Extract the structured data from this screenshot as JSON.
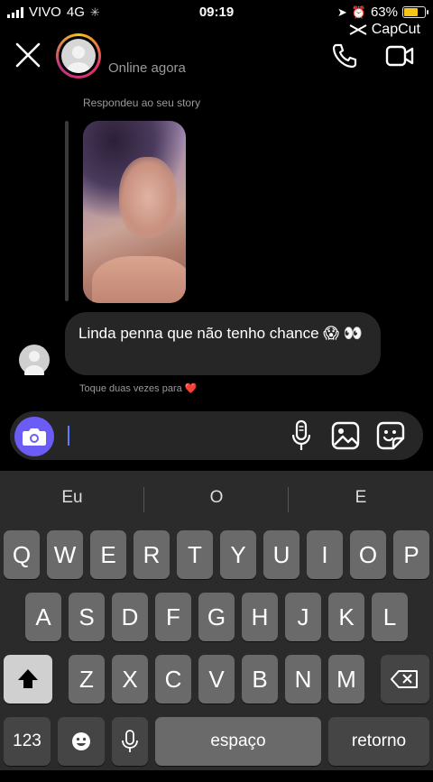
{
  "status_bar": {
    "carrier": "VIVO",
    "network": "4G",
    "time": "09:19",
    "battery": "63%",
    "battery_level": 0.63
  },
  "watermark": "CapCut",
  "header": {
    "status": "Online agora",
    "icons": [
      "close-icon",
      "phone-icon",
      "video-camera-icon"
    ]
  },
  "chat": {
    "story_reply_label": "Respondeu ao seu story",
    "message": "Linda penna que não tenho chance 😱 👀",
    "hint": "Toque duas vezes para ❤️"
  },
  "composer": {
    "value": "",
    "placeholder": "",
    "icons": [
      "camera-icon",
      "microphone-icon",
      "gallery-icon",
      "sticker-icon"
    ]
  },
  "keyboard": {
    "suggestions": [
      "Eu",
      "O",
      "E"
    ],
    "row1": [
      "Q",
      "W",
      "E",
      "R",
      "T",
      "Y",
      "U",
      "I",
      "O",
      "P"
    ],
    "row2": [
      "A",
      "S",
      "D",
      "F",
      "G",
      "H",
      "J",
      "K",
      "L"
    ],
    "row3": [
      "Z",
      "X",
      "C",
      "V",
      "B",
      "N",
      "M"
    ],
    "numbers_key": "123",
    "space_key": "espaço",
    "return_key": "retorno"
  },
  "colors": {
    "accent": "#6a5cf5",
    "bubble": "#262626",
    "battery": "#f5c518",
    "secondary_text": "#9a9a9a"
  }
}
